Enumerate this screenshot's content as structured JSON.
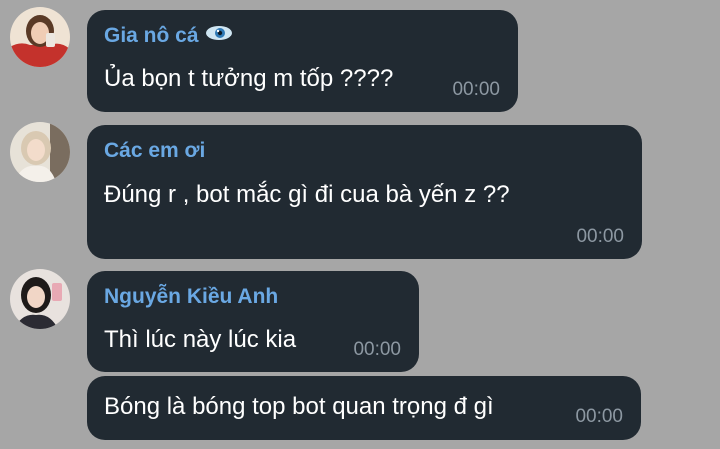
{
  "messages": [
    {
      "sender": "Gia nô cá",
      "sender_icon": "eye-icon",
      "text": "Ủa bọn t tưởng m tốp ????",
      "time": "00:00"
    },
    {
      "sender": "Các em ơi",
      "text": "Đúng r , bot mắc gì đi cua bà yến z ??",
      "time": "00:00"
    },
    {
      "sender": "Nguyễn Kiều Anh",
      "text": "Thì lúc này lúc kia",
      "time": "00:00"
    },
    {
      "text": "Bóng là bóng top bot quan trọng đ gì",
      "time": "00:00"
    }
  ],
  "colors": {
    "background": "#a6a6a6",
    "bubble": "#212a32",
    "sender_name": "#6aa8e3",
    "timestamp": "#8d98a2"
  }
}
